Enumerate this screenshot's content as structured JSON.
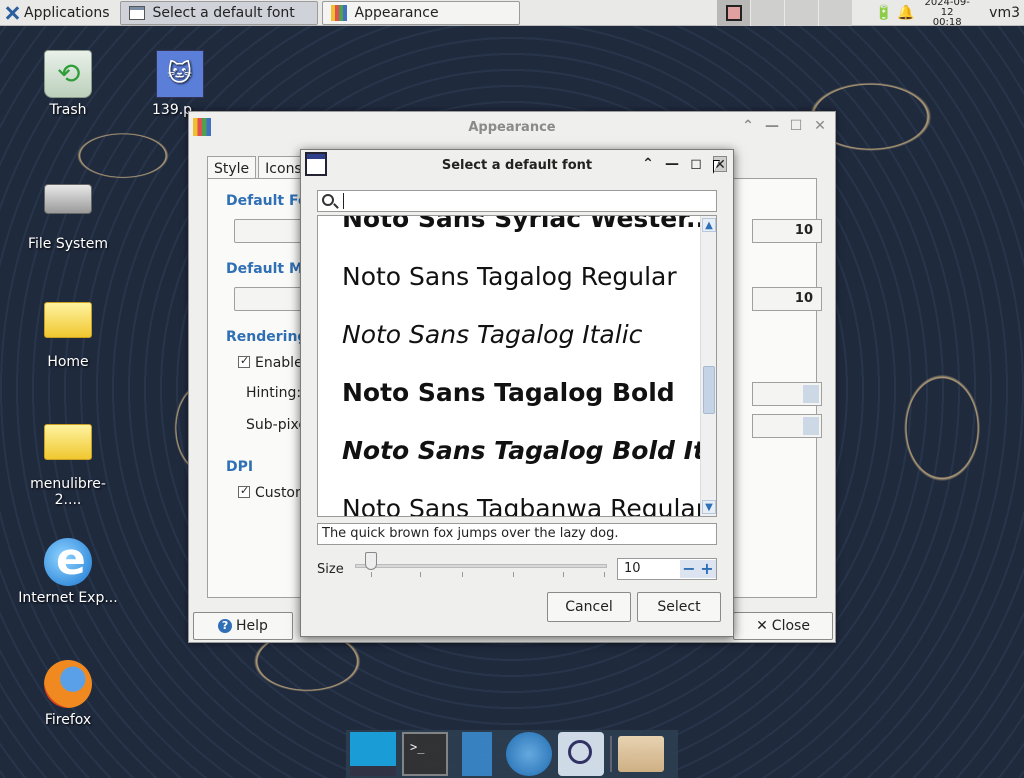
{
  "panel": {
    "apps_label": "Applications",
    "tasks": [
      {
        "label": "Select a default font"
      },
      {
        "label": "Appearance"
      }
    ],
    "clock_date": "2024-09-12",
    "clock_time": "00:18",
    "user": "vm3"
  },
  "desktop": {
    "icons": [
      {
        "label": "Trash"
      },
      {
        "label": "139.p"
      },
      {
        "label": "File System"
      },
      {
        "label": "Home"
      },
      {
        "label": "menulibre-2...."
      },
      {
        "label": "Internet Exp..."
      },
      {
        "label": "Firefox"
      }
    ]
  },
  "appearance": {
    "title": "Appearance",
    "tabs": [
      "Style",
      "Icons"
    ],
    "sections": {
      "default_font": "Default Fon",
      "default_mono": "Default Mo",
      "rendering": "Rendering",
      "dpi": "DPI"
    },
    "enable_label": "Enable a",
    "hinting_label": "Hinting:",
    "subpixel_label": "Sub-pixel",
    "custom_label": "Custom",
    "default_font_size": "10",
    "default_mono_size": "10",
    "help_label": "Help",
    "close_label": "Close"
  },
  "font_dialog": {
    "title": "Select a default font",
    "search_value": "",
    "fonts": [
      {
        "name": "Noto Sans Syriac Wester...",
        "style": "bold"
      },
      {
        "name": "Noto Sans Tagalog Regular",
        "style": "regular"
      },
      {
        "name": "Noto Sans Tagalog Italic",
        "style": "italic"
      },
      {
        "name": "Noto Sans Tagalog Bold",
        "style": "bold"
      },
      {
        "name": "Noto Sans Tagalog Bold Ita...",
        "style": "bold-italic"
      },
      {
        "name": "Noto Sans Tagbanwa Regular",
        "style": "regular"
      }
    ],
    "preview_text": "The quick brown fox jumps over the lazy dog.",
    "size_label": "Size",
    "size_value": "10",
    "cancel_label": "Cancel",
    "select_label": "Select"
  }
}
